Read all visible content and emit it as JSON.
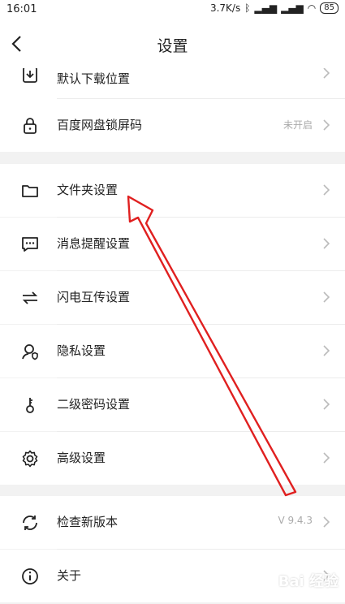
{
  "status_bar": {
    "time": "16:01",
    "speed": "3.7K/s",
    "battery": "85"
  },
  "header": {
    "title": "设置"
  },
  "rows": [
    {
      "label": "默认下载位置",
      "value": ""
    },
    {
      "label": "百度网盘锁屏码",
      "value": "未开启"
    },
    {
      "label": "文件夹设置",
      "value": ""
    },
    {
      "label": "消息提醒设置",
      "value": ""
    },
    {
      "label": "闪电互传设置",
      "value": ""
    },
    {
      "label": "隐私设置",
      "value": ""
    },
    {
      "label": "二级密码设置",
      "value": ""
    },
    {
      "label": "高级设置",
      "value": ""
    },
    {
      "label": "检查新版本",
      "value": "V 9.4.3"
    },
    {
      "label": "关于",
      "value": ""
    }
  ],
  "watermark": "Bai 经验",
  "annotation": {
    "color": "#e02020"
  }
}
